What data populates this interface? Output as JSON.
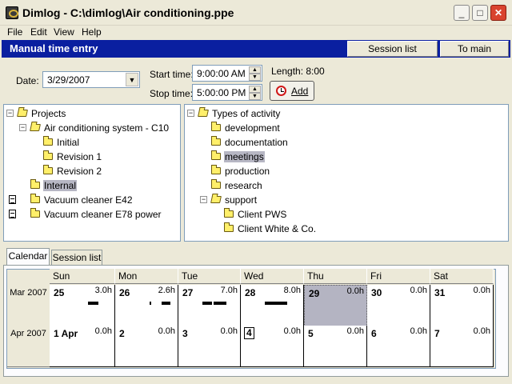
{
  "window": {
    "title": "Dimlog - C:\\dimlog\\Air conditioning.ppe",
    "minimize": "_",
    "maximize": "□",
    "close": "✕"
  },
  "menu": [
    "File",
    "Edit",
    "View",
    "Help"
  ],
  "header": {
    "title": "Manual time entry",
    "session_list_button": "Session list",
    "to_main_button": "To main"
  },
  "entry": {
    "date_label": "Date:",
    "date_value": "3/29/2007",
    "start_label": "Start time:",
    "start_value": "9:00:00 AM",
    "stop_label": "Stop time:",
    "stop_value": "5:00:00 PM",
    "length_label": "Length: 8:00",
    "add_button": "Add"
  },
  "projects_tree": [
    {
      "label": "Projects",
      "level": 0,
      "expander": "−",
      "icon": "folder-open-icon"
    },
    {
      "label": "Air conditioning system - C10",
      "level": 1,
      "expander": "−",
      "icon": "folder-open-icon"
    },
    {
      "label": "Initial",
      "level": 2,
      "icon": "folder-icon"
    },
    {
      "label": "Revision 1",
      "level": 2,
      "icon": "folder-icon"
    },
    {
      "label": "Revision 2",
      "level": 2,
      "icon": "folder-icon"
    },
    {
      "label": "Internal",
      "level": 1,
      "icon": "folder-icon",
      "selected": true
    },
    {
      "label": "Vacuum cleaner E42",
      "level": 1,
      "icon": "folder-icon",
      "doc": true
    },
    {
      "label": "Vacuum cleaner E78 power",
      "level": 1,
      "icon": "folder-icon",
      "doc": true
    }
  ],
  "activity_tree": [
    {
      "label": "Types of activity",
      "level": 0,
      "expander": "−",
      "icon": "folder-open-icon"
    },
    {
      "label": "development",
      "level": 1,
      "icon": "folder-icon"
    },
    {
      "label": "documentation",
      "level": 1,
      "icon": "folder-icon"
    },
    {
      "label": "meetings",
      "level": 1,
      "icon": "folder-icon",
      "selected": true
    },
    {
      "label": "production",
      "level": 1,
      "icon": "folder-icon"
    },
    {
      "label": "research",
      "level": 1,
      "icon": "folder-icon"
    },
    {
      "label": "support",
      "level": 1,
      "expander": "−",
      "icon": "folder-open-icon"
    },
    {
      "label": "Client PWS",
      "level": 2,
      "icon": "folder-icon"
    },
    {
      "label": "Client White & Co.",
      "level": 2,
      "icon": "folder-icon"
    }
  ],
  "tabs": {
    "calendar": "Calendar",
    "session_list": "Session list"
  },
  "calendar": {
    "days": [
      "Sun",
      "Mon",
      "Tue",
      "Wed",
      "Thu",
      "Fri",
      "Sat"
    ],
    "weeks": [
      {
        "month": "Mar 2007",
        "cells": [
          {
            "day": "25",
            "hours": "3.0h"
          },
          {
            "day": "26",
            "hours": "2.6h"
          },
          {
            "day": "27",
            "hours": "7.0h"
          },
          {
            "day": "28",
            "hours": "8.0h"
          },
          {
            "day": "29",
            "hours": "0.0h",
            "today": true
          },
          {
            "day": "30",
            "hours": "0.0h"
          },
          {
            "day": "31",
            "hours": "0.0h"
          }
        ]
      },
      {
        "month": "Apr 2007",
        "cells": [
          {
            "day": "1 Apr",
            "hours": "0.0h"
          },
          {
            "day": "2",
            "hours": "0.0h"
          },
          {
            "day": "3",
            "hours": "0.0h"
          },
          {
            "day": "4",
            "hours": "0.0h",
            "boxed": true
          },
          {
            "day": "5",
            "hours": "0.0h"
          },
          {
            "day": "6",
            "hours": "0.0h"
          },
          {
            "day": "7",
            "hours": "0.0h"
          }
        ]
      }
    ]
  }
}
